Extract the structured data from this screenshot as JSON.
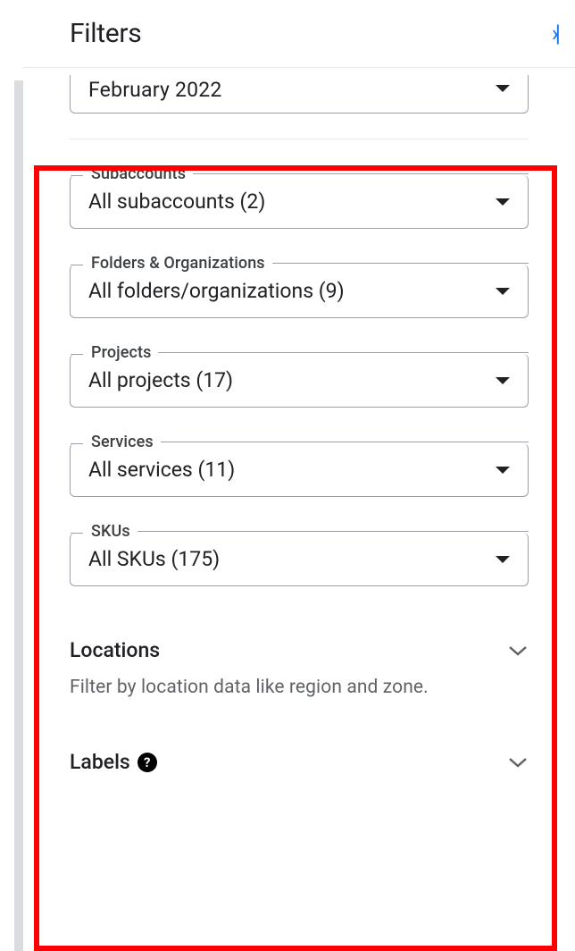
{
  "header": {
    "title": "Filters"
  },
  "dateFilter": {
    "value": "February 2022"
  },
  "filters": [
    {
      "label": "Subaccounts",
      "value": "All subaccounts (2)"
    },
    {
      "label": "Folders & Organizations",
      "value": "All folders/organizations (9)"
    },
    {
      "label": "Projects",
      "value": "All projects (17)"
    },
    {
      "label": "Services",
      "value": "All services (11)"
    },
    {
      "label": "SKUs",
      "value": "All SKUs (175)"
    }
  ],
  "expandables": {
    "locations": {
      "title": "Locations",
      "description": "Filter by location data like region and zone."
    },
    "labels": {
      "title": "Labels"
    }
  }
}
